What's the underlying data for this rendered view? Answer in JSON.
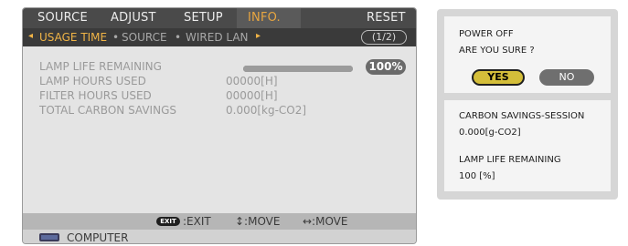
{
  "menu": {
    "tabs": [
      {
        "label": "SOURCE"
      },
      {
        "label": "ADJUST"
      },
      {
        "label": "SETUP"
      },
      {
        "label": "INFO."
      },
      {
        "label": "RESET"
      }
    ],
    "active_tab": "INFO."
  },
  "submenu": {
    "items": [
      {
        "label": "USAGE TIME"
      },
      {
        "label": "SOURCE"
      },
      {
        "label": "WIRED LAN"
      }
    ],
    "page": "(1/2)"
  },
  "info": {
    "lamp_life_remaining": {
      "label": "LAMP LIFE REMAINING",
      "percent": "100%",
      "fraction": 1.0
    },
    "lamp_hours_used": {
      "label": "LAMP HOURS USED",
      "value": "00000[H]"
    },
    "filter_hours_used": {
      "label": "FILTER HOURS USED",
      "value": "00000[H]"
    },
    "total_carbon_savings": {
      "label": "TOTAL CARBON SAVINGS",
      "value": "0.000[kg-CO2]"
    }
  },
  "footer": {
    "exit_key": "EXIT",
    "exit": ":EXIT",
    "move_vertical": "↕:MOVE",
    "move_horizontal": "↔:MOVE"
  },
  "source": {
    "label": "COMPUTER"
  },
  "dialog": {
    "title": "POWER OFF",
    "question": "ARE YOU SURE ?",
    "yes": "YES",
    "no": "NO",
    "carbon_label": "CARBON SAVINGS-SESSION",
    "carbon_value": "0.000[g-CO2]",
    "lamp_label": "LAMP LIFE REMAINING",
    "lamp_value": "100 [%]"
  },
  "colors": {
    "accent": "#f0b446",
    "yes_button": "#d4be3a",
    "menubar": "#4a4a4a"
  }
}
